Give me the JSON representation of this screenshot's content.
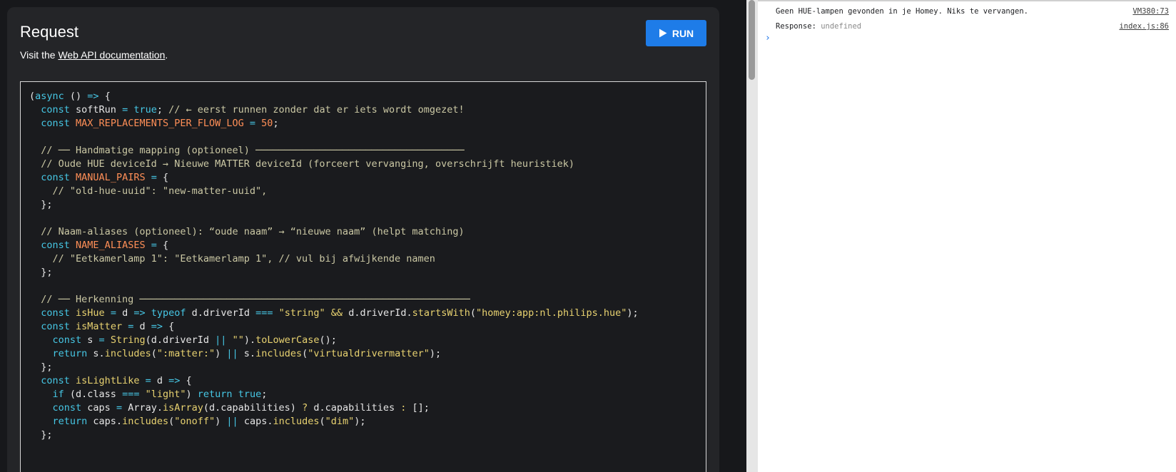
{
  "request": {
    "title": "Request",
    "doc_prefix": "Visit the ",
    "doc_link": "Web API documentation",
    "doc_suffix": ".",
    "run_label": "RUN"
  },
  "code": {
    "lines": [
      "(async () => {",
      "  const softRun = true; // ← eerst runnen zonder dat er iets wordt omgezet!",
      "  const MAX_REPLACEMENTS_PER_FLOW_LOG = 50;",
      "",
      "  // ── Handmatige mapping (optioneel) ────────────────────────────────────",
      "  // Oude HUE deviceId → Nieuwe MATTER deviceId (forceert vervanging, overschrijft heuristiek)",
      "  const MANUAL_PAIRS = {",
      "    // \"old-hue-uuid\": \"new-matter-uuid\",",
      "  };",
      "",
      "  // Naam-aliases (optioneel): “oude naam” → “nieuwe naam” (helpt matching)",
      "  const NAME_ALIASES = {",
      "    // \"Eetkamerlamp 1\": \"Eetkamerlamp 1\", // vul bij afwijkende namen",
      "  };",
      "",
      "  // ── Herkenning ─────────────────────────────────────────────────────────",
      "  const isHue = d => typeof d.driverId === \"string\" && d.driverId.startsWith(\"homey:app:nl.philips.hue\");",
      "  const isMatter = d => {",
      "    const s = String(d.driverId || \"\").toLowerCase();",
      "    return s.includes(\":matter:\") || s.includes(\"virtualdrivermatter\");",
      "  };",
      "  const isLightLike = d => {",
      "    if (d.class === \"light\") return true;",
      "    const caps = Array.isArray(d.capabilities) ? d.capabilities : [];",
      "    return caps.includes(\"onoff\") || caps.includes(\"dim\");",
      "  };"
    ]
  },
  "console": {
    "rows": [
      {
        "message": "Geen HUE-lampen gevonden in je Homey. Niks te vervangen.",
        "source": "VM380:73"
      },
      {
        "message": "Response: ",
        "value": "undefined",
        "source": "index.js:86"
      }
    ],
    "prompt": "›"
  },
  "colors": {
    "run_button": "#1e7ce8",
    "keyword": "#46c7e5",
    "comment": "#cbc8a4",
    "string": "#e8d270",
    "constant": "#ff8f57"
  }
}
